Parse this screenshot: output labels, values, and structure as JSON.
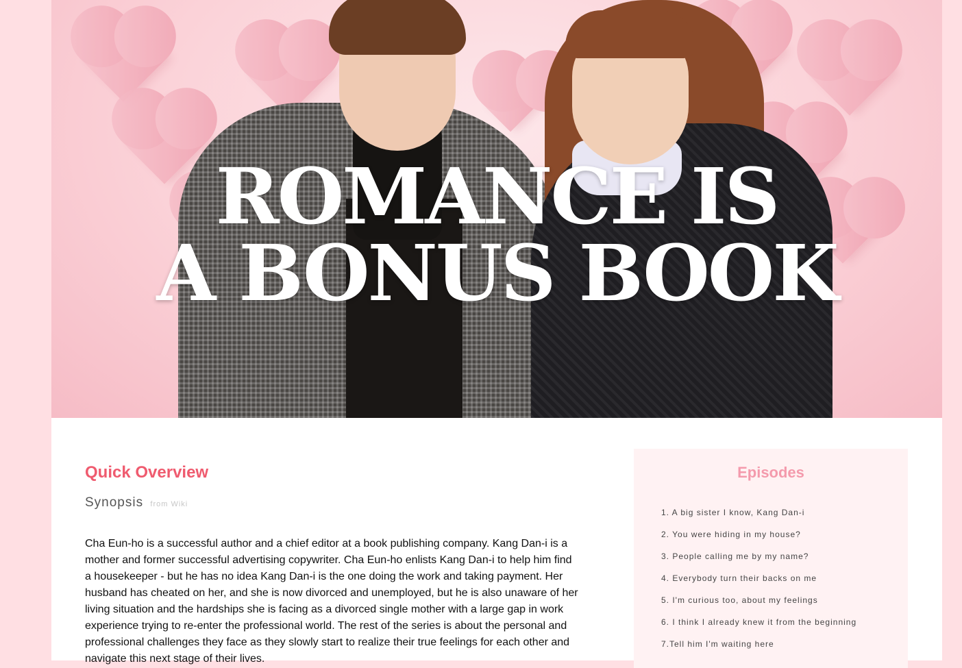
{
  "hero": {
    "title_line1": "ROMANCE IS",
    "title_line2": "A BONUS BOOK"
  },
  "overview": {
    "title": "Quick Overview",
    "synopsis_label": "Synopsis",
    "synopsis_source": "from Wiki",
    "synopsis_text": "Cha Eun-ho is a successful author and a chief editor at a book publishing company. Kang Dan-i is a mother and former successful advertising copywriter. Cha Eun-ho enlists Kang Dan-i to help him find a housekeeper - but he has no idea Kang Dan-i is the one doing the work and taking payment. Her husband has cheated on her, and she is now divorced and unemployed, but he is also unaware of her living situation and the hardships she is facing as a divorced single mother with a large gap in work experience trying to re-enter the professional world. The rest of the series is about the personal and professional challenges they face as they slowly start to realize their true feelings for each other and navigate this next stage of their lives."
  },
  "episodes": {
    "title": "Episodes",
    "items": [
      "1. A big sister I know, Kang Dan-i",
      "2. You were hiding in my house?",
      "3. People calling me by my name?",
      "4. Everybody turn their backs on me",
      "5. I'm curious too, about my feelings",
      "6. I think I already knew it from the beginning",
      "7.Tell him I'm waiting here"
    ]
  },
  "colors": {
    "page_bg": "#ffdfe3",
    "accent": "#ef5b6f",
    "episodes_title": "#f49aac",
    "episodes_bg": "#fff2f3"
  }
}
